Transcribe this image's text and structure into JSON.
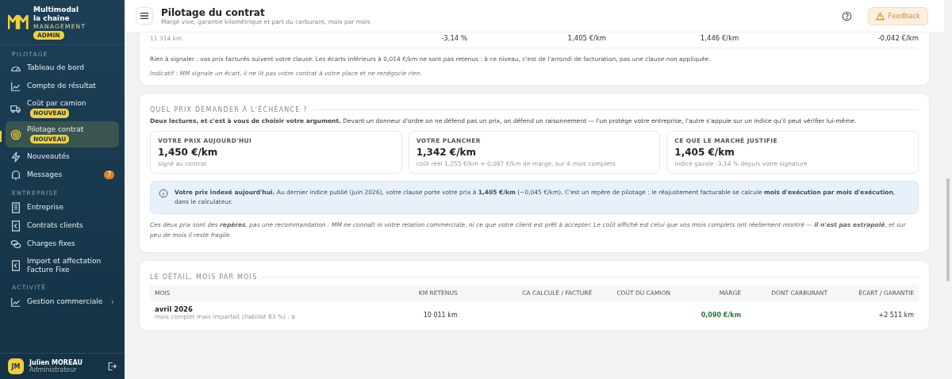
{
  "sidebar": {
    "brand": {
      "name_line1": "Multimodal",
      "name_line2": "la chaîne",
      "tagline": "MANAGEMENT",
      "role_badge": "ADMIN"
    },
    "sections": [
      {
        "title": "PILOTAGE",
        "items": [
          {
            "label": "Tableau de bord",
            "selected": false
          },
          {
            "label": "Compte de résultat",
            "selected": false
          },
          {
            "label": "Coût par camion",
            "badge": "NOUVEAU",
            "selected": false
          },
          {
            "label": "Pilotage contrat",
            "badge": "NOUVEAU",
            "selected": true
          },
          {
            "label": "Nouveautés",
            "selected": false
          },
          {
            "label": "Messages",
            "count": "7",
            "selected": false
          }
        ]
      },
      {
        "title": "ENTREPRISE",
        "items": [
          {
            "label": "Entreprise",
            "selected": false
          },
          {
            "label": "Contrats clients",
            "selected": false
          },
          {
            "label": "Charges fixes",
            "selected": false
          },
          {
            "label": "Import et affectation Facture Fixe",
            "selected": false
          }
        ]
      },
      {
        "title": "ACTIVITÉ",
        "items": [
          {
            "label": "Gestion commerciale",
            "chevron": "›",
            "selected": false
          }
        ]
      }
    ],
    "user": {
      "initials": "JM",
      "name": "Julien MOREAU",
      "role": "Administrateur"
    }
  },
  "header": {
    "title": "Pilotage du contrat",
    "subtitle": "Marge vive, garantie kilométrique et part du carburant, mois par mois",
    "feedback_button": "Feedback"
  },
  "clause_card": {
    "row": {
      "km": "11 314 km",
      "index_change": "-3,14 %",
      "indexed_price": "1,405 €/km",
      "billed_price": "1,446 €/km",
      "gap": "-0,042 €/km"
    },
    "message": "Rien à signaler : vos prix facturés suivent votre clause. Les écarts inférieurs à 0,014 €/km ne sont pas retenus : à ce niveau, c'est de l'arrondi de facturation, pas une clause non appliquée.",
    "disclaimer": "Indicatif : MM signale un écart, il ne lit pas votre contrat à votre place et ne renégocie rien."
  },
  "price_card": {
    "section_title": "QUEL PRIX DEMANDER À L'ÉCHÉANCE ?",
    "intro": "**Deux lectures, et c'est à vous de choisir votre argument.** Devant un donneur d'ordre on ne défend pas un prix, on défend un raisonnement — l'un protège votre entreprise, l'autre s'appuie sur un indice qu'il peut vérifier lui-même.",
    "tiles": [
      {
        "label": "VOTRE PRIX AUJOURD'HUI",
        "value": "1,450 €/km",
        "note": "signé au contrat"
      },
      {
        "label": "VOTRE PLANCHER",
        "value": "1,342 €/km",
        "note": "coût réel 1,255 €/km + 0,087 €/km de marge, sur 4 mois complets"
      },
      {
        "label": "CE QUE LE MARCHÉ JUSTIFIE",
        "value": "1,405 €/km",
        "note": "indice gazole -3,14 % depuis votre signature"
      }
    ],
    "info": "**Votre prix indexé aujourd'hui.** Au dernier indice publié (juin 2026), votre clause porte votre prix à **1,405 €/km** (−0,045 €/km). C'est un repère de pilotage : le réajustement facturable se calcule **mois d'exécution par mois d'exécution**, dans le calculateur.",
    "footnote": "Ces deux prix sont des **repères**, pas une recommandation : MM ne connaît ni votre relation commerciale, ni ce que votre client est prêt à accepter. Le coût affiché est celui que vos mois complets ont réellement montré — **il n'est pas extrapolé**, et sur peu de mois il reste fragile."
  },
  "detail_card": {
    "section_title": "LE DÉTAIL, MOIS PAR MOIS",
    "columns": [
      "MOIS",
      "KM RETENUS",
      "CA CALCULÉ / FACTURÉ",
      "COÛT DU CAMION",
      "MARGE",
      "DONT CARBURANT",
      "ÉCART / GARANTIE"
    ],
    "rows": [
      {
        "month": "avril 2026",
        "note": "mois complet mais imparfait (fiabilité 83 %) : à",
        "km": "10 011 km",
        "margin": "0,090 €/km",
        "gap": "+2 511 km"
      }
    ]
  }
}
